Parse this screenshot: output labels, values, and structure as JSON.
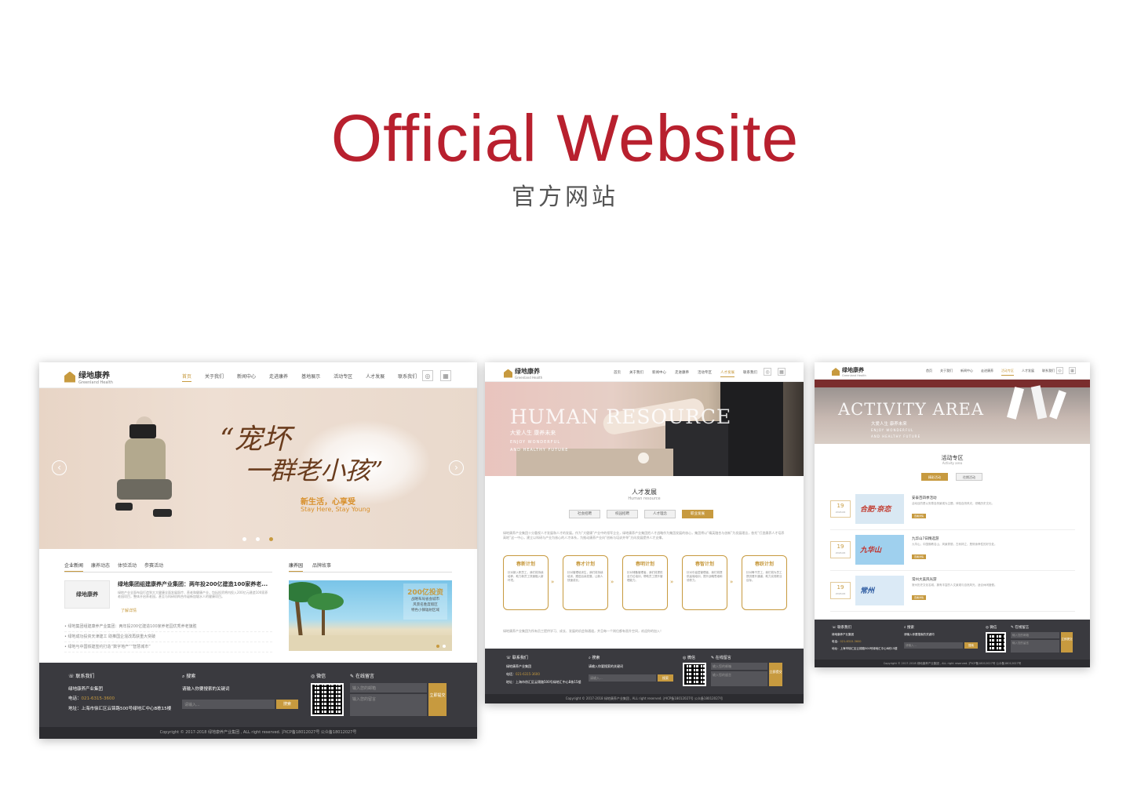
{
  "header": {
    "title": "Official Website",
    "subtitle": "官方网站"
  },
  "brand": {
    "name": "绿地康养",
    "en": "Greenland Health",
    "accent": "#c79a3f",
    "title_color": "#b8202e"
  },
  "shot1": {
    "nav": [
      "首页",
      "关于我们",
      "新闻中心",
      "走进康养",
      "基地展示",
      "活动专区",
      "人才发展",
      "联系我们"
    ],
    "active_index": 0,
    "slogan_line1": "“宠坏",
    "slogan_line2": "一群老小孩”",
    "slogan_cn": "新生活，心享受",
    "slogan_en": "Stay Here, Stay Young",
    "news_tabs": [
      "企业新闻",
      "康养动态",
      "体验活动",
      "参赛活动"
    ],
    "right_tabs": [
      "康养园",
      "品牌故事"
    ],
    "news_title": "绿地集团组建康养产业集团：两年投200亿建造100家养老...",
    "news_body": "绿地产业全面布局打造到大大健康全面发展医疗、养老和健康产业，包括投资将内投入200亿元建造100家养老园项目，整体开启养老园，甚至与科研机构合作诞新加坡水人的健康项目。",
    "more": "了解详情",
    "list": [
      "绿地集团组建康养产业集团：两年投200亿建造100家养老园优秀养老旗胜",
      "绿地成功投资天津建工 助推国企混改再获重大突破",
      "绿地与中国铁建签约打造“数字地产”“智慧城市”"
    ],
    "promo_title": "200亿投资",
    "promo_lines": [
      "战略布局省会城市",
      "风景名胜度假区",
      "特色小镇辐射区域"
    ],
    "contact_title": "联系我们",
    "company": "绿地康养产业集团",
    "phone_label": "电话：",
    "phone": "021-6315-3600",
    "address": "地址：上海市徐汇区云锦路500号绿地汇中心B栋15楼",
    "search_title": "搜索",
    "search_hint": "请输入你要搜索的关键词",
    "search_ph": "请输入...",
    "search_btn": "搜索",
    "wechat": "微信",
    "msg_title": "在线留言",
    "msg_ph1": "输入您的邮箱",
    "msg_ph2": "输入您的留言",
    "submit": "立即提交",
    "copyright": "Copyright © 2017-2018 绿地康养产业集团 , ALL right reserved. 沪ICP备18012027号 公众备18012027号"
  },
  "shot2": {
    "nav": [
      "首页",
      "关于我们",
      "新闻中心",
      "走进康养",
      "活动专区",
      "人才发展",
      "联系我们"
    ],
    "active_index": 5,
    "banner_en": "HUMAN RESOURCE",
    "banner_cn": "大爱人生  康养未来",
    "banner_en2": "ENJOY WONDERFUL",
    "banner_en3": "AND HEALTHY FUTURE",
    "section_title": "人才发展",
    "section_en": "Human resource",
    "tabs": [
      "社会招聘",
      "校园招聘",
      "人才理念",
      "职业发展"
    ],
    "tab_active": 3,
    "intro": "绿地康养产业集团十分重视人才发展和人才的发展。作为“大健康”产业中的领军企业，绿地康养产业集团把人才战略作为集团发展的核心，集团将以“精英融合与创新”为发展理念，依托“打造康养人才培养高地”这一中心，建立以科研与产业为核心的人才体系，为推动康养产业向“创新与培训并举”方向发展提供人才支撑。",
    "plans": [
      {
        "t": "春新计划",
        "d": "针对新入职员工，我们将持续培养，助力新员工快速融入新环境。"
      },
      {
        "t": "春才计划",
        "d": "针对管理培训生，我们将持续培训，跟进后续发展，让新人快速成长。"
      },
      {
        "t": "春明计划",
        "d": "针对储备管理者，我们将提供全方位培训，帮助员工提升管理能力。"
      },
      {
        "t": "春智计划",
        "d": "针对中高层管理者，我们将提供高端培训，提升战略思维和领导力。"
      },
      {
        "t": "春跃计划",
        "d": "针对骨干员工，我们将为员工提供晋升通道，助力实现职业目标。"
      }
    ],
    "outro": "绿地康养产业集团为所有员工提供学习、成长、发展的机会和通道，并且每一个岗位都有晋升空间，欢迎你的加入！",
    "copyright": "Copyright © 2017-2018 绿地康养产业集团 , ALL right reserved. 沪ICP备18012027号 公众备18012027号"
  },
  "shot3": {
    "nav": [
      "首页",
      "关于我们",
      "新闻中心",
      "走进康养",
      "活动专区",
      "人才发展",
      "联系我们"
    ],
    "active_index": 4,
    "banner_en": "ACTIVITY AREA",
    "banner_cn": "大爱人生  康养未来",
    "banner_en2": "ENJOY WONDERFUL",
    "banner_en3": "AND HEALTHY FUTURE",
    "section_title": "活动专区",
    "section_en": "Activity area",
    "tabs": [
      "精彩活动",
      "往期活动"
    ],
    "tab_active": 0,
    "items": [
      {
        "day": "19",
        "ym": "2018-06",
        "title": "安泰百四季活动",
        "body": "活动目的是以安泰自然景观为主题，体验自然风光，领略历史文化。",
        "img_text": "合肥·奈恋"
      },
      {
        "day": "19",
        "ym": "2018-06",
        "title": "九华山7日精选游",
        "body": "九华山，中国佛教名山，风景秀丽，古刹林立，是修身养性的好去处。",
        "img_text": "九华山"
      },
      {
        "day": "19",
        "ym": "2018-06",
        "title": "常州大美风光游",
        "body": "常州历史文化名城，拥有丰富的人文景观与自然风光，适合休闲度假。",
        "img_text": "常州"
      }
    ],
    "more": "查看详情",
    "copyright": "Copyright © 2017-2018 绿地康养产业集团 , ALL right reserved. 沪ICP备18012027号 公众备18012027号"
  }
}
